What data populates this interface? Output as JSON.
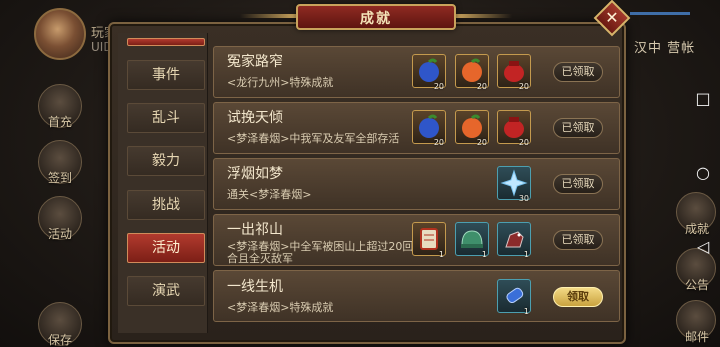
{
  "hud": {
    "player_name": "玩家",
    "uid_label": "UID",
    "location": "汉中 营帐",
    "left_buttons": [
      "首充",
      "签到",
      "活动",
      "保存"
    ],
    "right_buttons": [
      "成就",
      "公告",
      "邮件"
    ]
  },
  "modal": {
    "title": "成就",
    "close_symbol": "✕",
    "tabs": [
      "事件",
      "乱斗",
      "毅力",
      "挑战",
      "活动",
      "演武"
    ],
    "active_tab_index": 4,
    "achievements": [
      {
        "title": "冤家路窄",
        "desc": "<龙行九州>特殊成就",
        "rewards": [
          {
            "icon": "blue-fruit-icon",
            "count": "20"
          },
          {
            "icon": "orange-fruit-icon",
            "count": "20"
          },
          {
            "icon": "red-pouch-icon",
            "count": "20"
          }
        ],
        "button": "已领取",
        "claimed": true
      },
      {
        "title": "试挽天倾",
        "desc": "<梦泽春烟>中我军及友军全部存活",
        "rewards": [
          {
            "icon": "blue-fruit-icon",
            "count": "20"
          },
          {
            "icon": "orange-fruit-icon",
            "count": "20"
          },
          {
            "icon": "red-pouch-icon",
            "count": "20"
          }
        ],
        "button": "已领取",
        "claimed": true
      },
      {
        "title": "浮烟如梦",
        "desc": "通关<梦泽春烟>",
        "rewards": [
          {
            "icon": "ice-crystal-icon",
            "count": "30"
          }
        ],
        "button": "已领取",
        "claimed": true
      },
      {
        "title": "一出祁山",
        "desc": "<梦泽春烟>中全军被困山上超过20回合且全灭敌军",
        "rewards": [
          {
            "icon": "scroll-token-icon",
            "count": "1"
          },
          {
            "icon": "green-helmet-icon",
            "count": "1"
          },
          {
            "icon": "red-mount-icon",
            "count": "1"
          }
        ],
        "button": "已领取",
        "claimed": true
      },
      {
        "title": "一线生机",
        "desc": "<梦泽春烟>特殊成就",
        "rewards": [
          {
            "icon": "blue-capsule-icon",
            "count": "1"
          }
        ],
        "button": "领取",
        "claimed": false
      }
    ]
  },
  "system_nav": {
    "square": "□",
    "circle": "○",
    "back": "◁"
  },
  "colors": {
    "accent_red": "#8f2a22",
    "gold": "#c9a35c",
    "claim_ready": "#f3da86"
  }
}
